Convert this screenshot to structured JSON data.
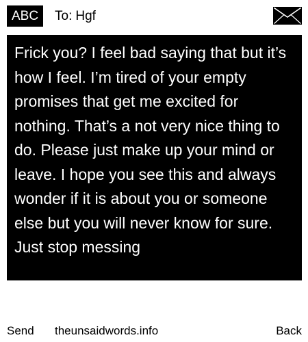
{
  "header": {
    "badge_label": "ABC",
    "to_label": "To:",
    "recipient": "Hgf",
    "envelope_icon": "envelope-icon"
  },
  "message": {
    "body": "Frick you? I feel bad saying that but it’s how I feel. I’m tired of your empty promises that get me excited for nothing. That’s a not very nice thing to do. Please just make up your mind or leave. I hope you see this and always wonder if it is about you or someone else but you will never know for sure. Just stop messing"
  },
  "footer": {
    "send_label": "Send",
    "site_label": "theunsaidwords.info",
    "back_label": "Back"
  },
  "colors": {
    "background": "#ffffff",
    "foreground": "#000000",
    "message_bg": "#000000",
    "message_text": "#ffffff"
  }
}
